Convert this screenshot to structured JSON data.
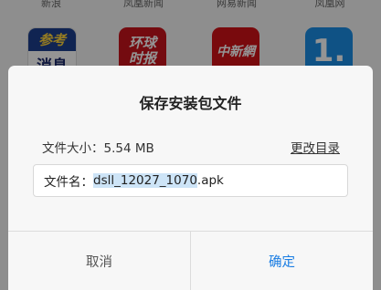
{
  "background": {
    "apps": [
      {
        "label": "新浪",
        "icon_text": "参考\n消息",
        "icon": "cankao-xiaoxi-app-icon"
      },
      {
        "label": "凤凰新闻",
        "icon_text": "环球时报",
        "icon": "huanqiu-shibao-app-icon"
      },
      {
        "label": "网易新闻",
        "icon_text": "中新網",
        "icon": "zhongxin-app-icon"
      },
      {
        "label": "凤凰网",
        "icon_text": "1.",
        "icon": "yidian-app-icon"
      }
    ]
  },
  "dialog": {
    "title": "保存安装包文件",
    "size_label": "文件大小：5.54 MB",
    "change_dir_label": "更改目录",
    "filename_prefix": "文件名：",
    "filename_selected": "dsll_12027_1070",
    "filename_ext": ".apk",
    "cancel_label": "取消",
    "ok_label": "确定"
  },
  "colors": {
    "accent": "#1a7de3",
    "selection": "#cde4f7",
    "dialog_bg": "#f7f7f7"
  }
}
